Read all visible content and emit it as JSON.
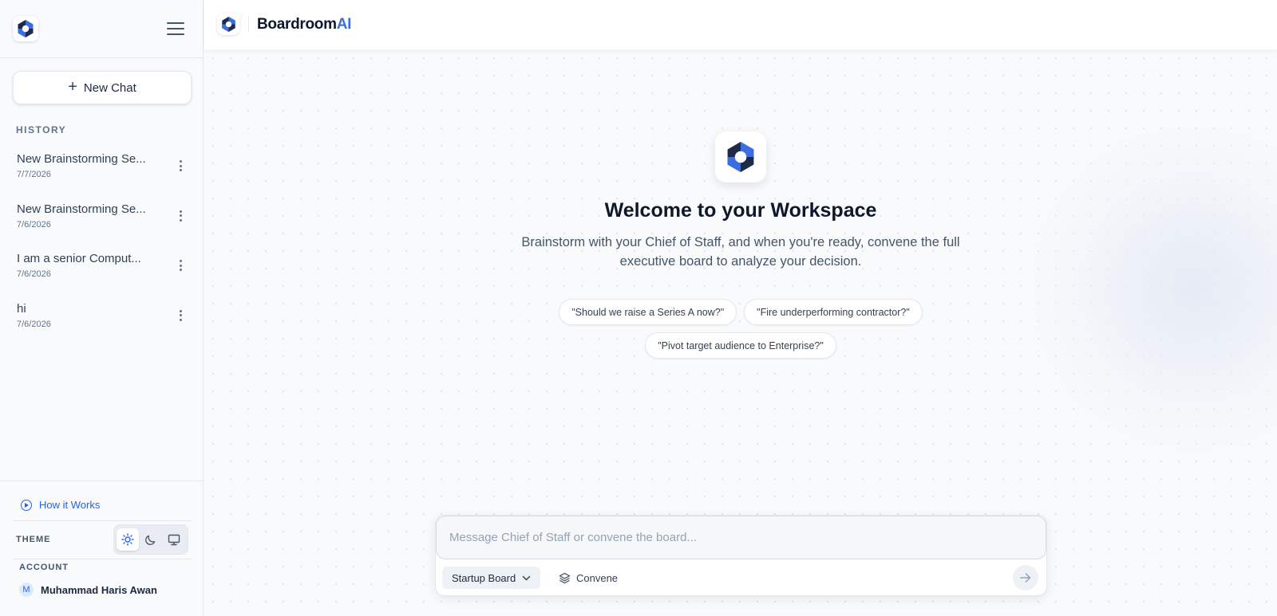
{
  "app": {
    "brand_main": "Boardroom",
    "brand_accent": "AI",
    "brand_accent_color": "#3b6fe0"
  },
  "sidebar": {
    "new_chat_label": "New Chat",
    "history_label": "HISTORY",
    "history": [
      {
        "title": "New Brainstorming Se...",
        "date": "7/7/2026"
      },
      {
        "title": "New Brainstorming Se...",
        "date": "7/6/2026"
      },
      {
        "title": "I am a senior Comput...",
        "date": "7/6/2026"
      },
      {
        "title": "hi",
        "date": "7/6/2026"
      }
    ],
    "how_it_works_label": "How it Works",
    "theme_label": "THEME",
    "theme_options": [
      "light",
      "dark",
      "system"
    ],
    "theme_selected": "light",
    "account_label": "ACCOUNT",
    "account_initial": "M",
    "account_name": "Muhammad Haris Awan"
  },
  "main": {
    "welcome_title": "Welcome to your Workspace",
    "subtitle": "Brainstorm with your Chief of Staff, and when you're ready, convene the full executive board to analyze your decision.",
    "suggestions": [
      "\"Should we raise a Series A now?\"",
      "\"Fire underperforming contractor?\"",
      "\"Pivot target audience to Enterprise?\""
    ]
  },
  "composer": {
    "placeholder": "Message Chief of Staff or convene the board...",
    "value": "",
    "board_selected": "Startup Board",
    "convene_label": "Convene"
  },
  "colors": {
    "accent": "#2563eb",
    "logo_dark": "#1e2a4a",
    "logo_blue": "#3b6fe0"
  },
  "icons": [
    "logo-icon",
    "hamburger-icon",
    "plus-icon",
    "kebab-icon",
    "play-circle-icon",
    "sun-icon",
    "moon-icon",
    "monitor-icon",
    "chevron-down-icon",
    "layers-icon",
    "arrow-right-icon"
  ]
}
